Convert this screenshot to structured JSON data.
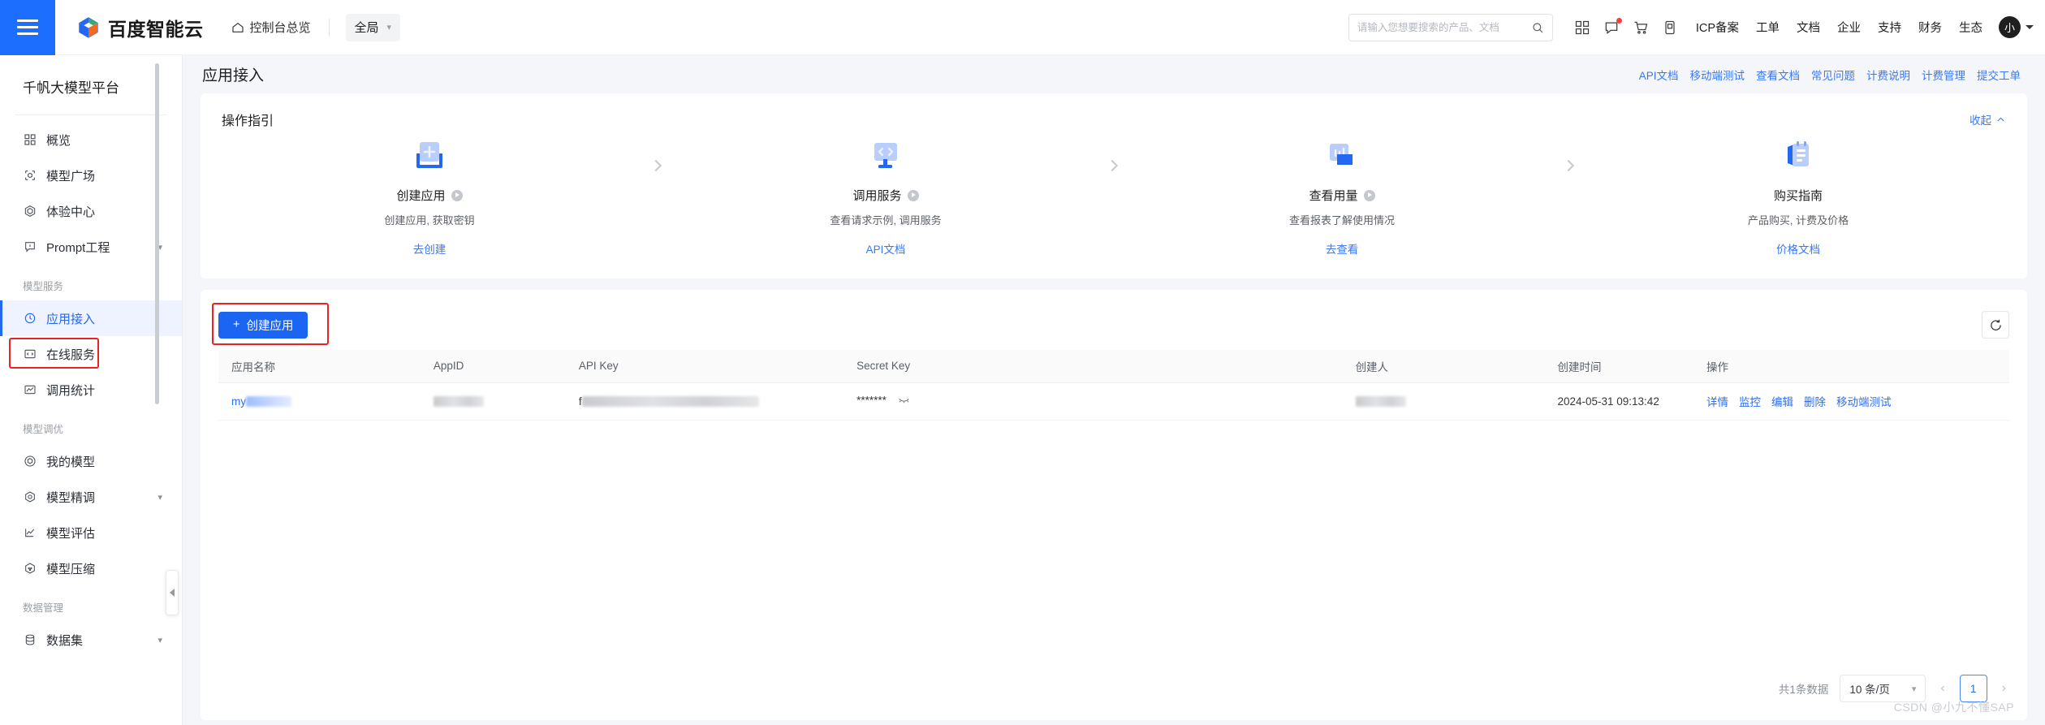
{
  "topbar": {
    "menu_icon": "hamburger-icon",
    "brand": "百度智能云",
    "console_link": "控制台总览",
    "console_icon": "home-icon",
    "scope": "全局",
    "search_placeholder": "请输入您想要搜索的产品、文档",
    "search_value": "",
    "search_icon": "search-icon",
    "icons": [
      {
        "name": "apps-grid-icon"
      },
      {
        "name": "message-icon",
        "badge": true
      },
      {
        "name": "cart-icon"
      },
      {
        "name": "mobile-icon"
      }
    ],
    "links": [
      "ICP备案",
      "工单",
      "文档",
      "企业",
      "支持",
      "财务",
      "生态"
    ],
    "avatar_label": "小"
  },
  "sidebar": {
    "title": "千帆大模型平台",
    "items": [
      {
        "label": "概览",
        "icon": "grid-icon",
        "active": false,
        "expandable": false
      },
      {
        "label": "模型广场",
        "icon": "cube-outline-icon",
        "active": false,
        "expandable": false
      },
      {
        "label": "体验中心",
        "icon": "hexagon-icon",
        "active": false,
        "expandable": false
      },
      {
        "label": "Prompt工程",
        "icon": "chat-icon",
        "active": false,
        "expandable": true
      }
    ],
    "groups": [
      {
        "label": "模型服务",
        "items": [
          {
            "label": "应用接入",
            "icon": "plug-icon",
            "active": true,
            "expandable": false
          },
          {
            "label": "在线服务",
            "icon": "code-icon",
            "active": false,
            "expandable": false
          },
          {
            "label": "调用统计",
            "icon": "chart-icon",
            "active": false,
            "expandable": false
          }
        ]
      },
      {
        "label": "模型调优",
        "items": [
          {
            "label": "我的模型",
            "icon": "cube-circle-icon",
            "active": false,
            "expandable": false
          },
          {
            "label": "模型精调",
            "icon": "target-icon",
            "active": false,
            "expandable": true
          },
          {
            "label": "模型评估",
            "icon": "chart-edit-icon",
            "active": false,
            "expandable": false
          },
          {
            "label": "模型压缩",
            "icon": "compress-icon",
            "active": false,
            "expandable": false
          }
        ]
      },
      {
        "label": "数据管理",
        "items": [
          {
            "label": "数据集",
            "icon": "database-icon",
            "active": false,
            "expandable": true
          }
        ]
      }
    ]
  },
  "page": {
    "title": "应用接入",
    "head_links": [
      "API文档",
      "移动端测试",
      "查看文档",
      "常见问题",
      "计费说明",
      "计费管理",
      "提交工单"
    ]
  },
  "guide": {
    "title": "操作指引",
    "collapse_label": "收起",
    "collapse_icon": "chevron-up-icon",
    "steps": [
      {
        "icon": "create-app-icon",
        "title": "创建应用",
        "has_play": true,
        "desc": "创建应用, 获取密钥",
        "link": "去创建"
      },
      {
        "icon": "call-service-icon",
        "title": "调用服务",
        "has_play": true,
        "desc": "查看请求示例, 调用服务",
        "link": "API文档"
      },
      {
        "icon": "view-usage-icon",
        "title": "查看用量",
        "has_play": true,
        "desc": "查看报表了解使用情况",
        "link": "去查看"
      },
      {
        "icon": "purchase-guide-icon",
        "title": "购买指南",
        "has_play": false,
        "desc": "产品购买, 计费及价格",
        "link": "价格文档"
      }
    ]
  },
  "list": {
    "create_button": "创建应用",
    "create_button_icon": "plus-icon",
    "refresh_icon": "refresh-icon",
    "columns": [
      "应用名称",
      "AppID",
      "API Key",
      "Secret Key",
      "创建人",
      "创建时间",
      "操作"
    ],
    "rows": [
      {
        "app_name_prefix": "my",
        "app_name_masked": true,
        "app_id_masked": true,
        "api_key_prefix": "f",
        "api_key_masked": true,
        "secret_key": "*******",
        "secret_key_icon": "eye-off-icon",
        "creator_masked": true,
        "created_at": "2024-05-31 09:13:42",
        "operations": [
          "详情",
          "监控",
          "编辑",
          "删除",
          "移动端测试"
        ]
      }
    ]
  },
  "pagination": {
    "total_label": "共1条数据",
    "page_size": "10 条/页",
    "page_size_icon": "chevron-down-icon",
    "prev_icon": "chevron-left-icon",
    "next_icon": "chevron-right-icon",
    "current_page": "1"
  },
  "watermark": "CSDN @小九不懂SAP",
  "colors": {
    "primary": "#1c64f2",
    "link": "#3a78f2",
    "accent_highlight": "#ec2222",
    "hamburger_bg": "#1c6eff"
  }
}
